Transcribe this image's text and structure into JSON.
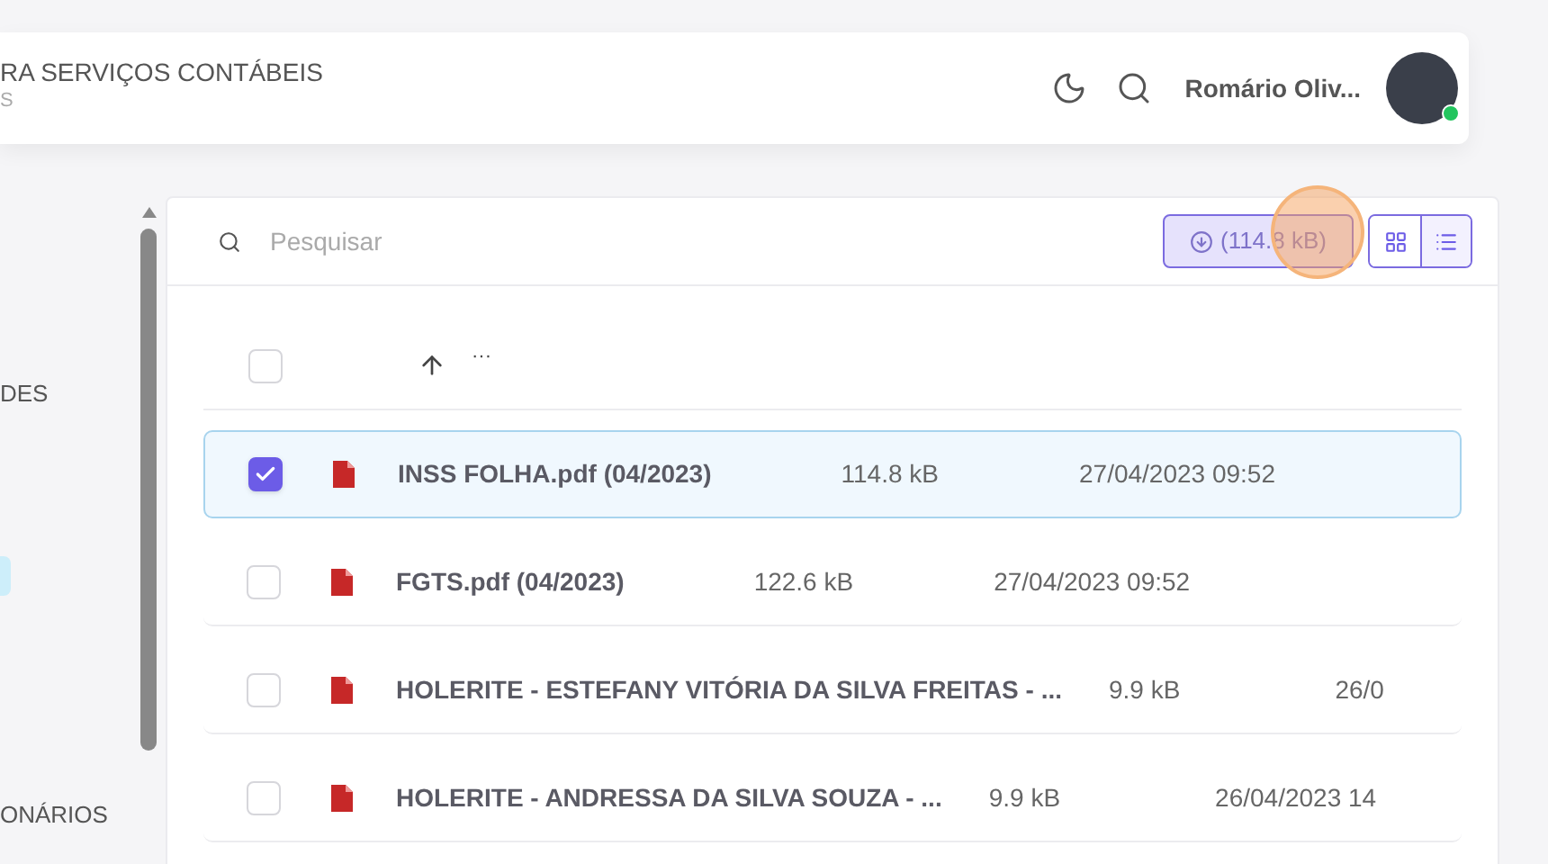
{
  "header": {
    "title": "RA SERVIÇOS CONTÁBEIS",
    "subtitle": "S",
    "user_name": "Romário Oliv...",
    "online": true
  },
  "sidebar": {
    "items": [
      {
        "label": "DES",
        "selected": false
      },
      {
        "selected": true
      },
      {
        "label": "ONÁRIOS",
        "selected": false
      }
    ]
  },
  "toolbar": {
    "search": {
      "placeholder": "Pesquisar"
    },
    "download_label": "(114.8 kB)",
    "views": [
      {
        "kind": "grid",
        "selected": false
      },
      {
        "kind": "list",
        "selected": true
      }
    ]
  },
  "table": {
    "header": {
      "checked": false,
      "more": "···"
    },
    "rows": [
      {
        "name": "INSS FOLHA.pdf (04/2023)",
        "size": "114.8 kB",
        "date": "27/04/2023 09:52",
        "checked": true
      },
      {
        "name": "FGTS.pdf (04/2023)",
        "size": "122.6 kB",
        "date": "27/04/2023 09:52",
        "checked": false
      },
      {
        "name": "HOLERITE - ESTEFANY VITÓRIA DA SILVA FREITAS - ...",
        "size": "9.9 kB",
        "date": "26/0",
        "checked": false
      },
      {
        "name": "HOLERITE - ANDRESSA DA SILVA SOUZA - ...",
        "size": "9.9 kB",
        "date": "26/04/2023 14",
        "checked": false
      }
    ]
  }
}
